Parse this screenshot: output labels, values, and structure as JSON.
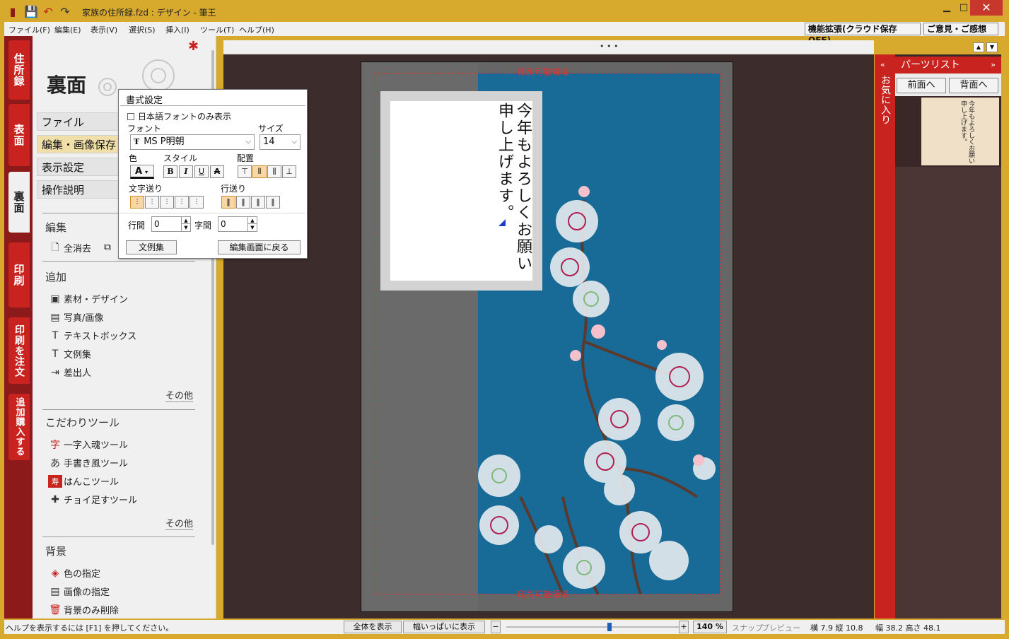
{
  "window": {
    "title": "家族の住所録.fzd : デザイン - 筆王",
    "minimize": "▁",
    "maximize": "□",
    "close": "✕"
  },
  "menu": {
    "items": [
      "ファイル(F)",
      "編集(E)",
      "表示(V)",
      "選択(S)",
      "挿入(I)",
      "ツール(T)",
      "ヘルプ(H)"
    ],
    "cloud": "機能拡張(クラウド保存OFF)",
    "feedback": "ご意見・ご感想"
  },
  "left_tabs": [
    "住所録",
    "表面",
    "裏面",
    "印刷",
    "印刷を注文",
    "追加購入する"
  ],
  "panel": {
    "title": "裏面",
    "buttons": [
      "ファイル",
      "編集・画像保存",
      "表示設定",
      "操作説明"
    ],
    "sections": {
      "edit": {
        "title": "編集",
        "items": [
          "全消去"
        ]
      },
      "add": {
        "title": "追加",
        "items": [
          "素材・デザイン",
          "写真/画像",
          "テキストボックス",
          "文例集",
          "差出人"
        ],
        "more": "その他"
      },
      "tools": {
        "title": "こだわりツール",
        "items": [
          "一字入魂ツール",
          "手書き風ツール",
          "はんこツール",
          "チョイ足すツール"
        ],
        "more": "その他"
      },
      "bg": {
        "title": "背景",
        "items": [
          "色の指定",
          "画像の指定",
          "背景のみ削除"
        ]
      }
    }
  },
  "canvas": {
    "dots": "• • •",
    "print_area_label": "印刷可能領域",
    "text_col1": "今年もよろしくお願い",
    "text_col2": "申し上げます。"
  },
  "dialog": {
    "title": "書式設定",
    "jp_font_only": "日本語フォントのみ表示",
    "font_label": "フォント",
    "font_value": "MS P明朝",
    "size_label": "サイズ",
    "size_value": "14",
    "color_label": "色",
    "style_label": "スタイル",
    "align_label": "配置",
    "char_feed_label": "文字送り",
    "line_feed_label": "行送り",
    "line_gap_label": "行間",
    "line_gap_value": "0",
    "char_gap_label": "字間",
    "char_gap_value": "0",
    "templates_button": "文例集",
    "back_button": "編集画面に戻る",
    "style_glyphs": [
      "B",
      "I",
      "U",
      "A"
    ]
  },
  "right_panel": {
    "favorites": "お気に入り",
    "title": "パーツリスト",
    "front": "前面へ",
    "back": "背面へ",
    "thumb_col1": "今年もよろしくお願い",
    "thumb_col2": "申し上げます。"
  },
  "status": {
    "help": "ヘルプを表示するには [F1] を押してください。",
    "fit_all": "全体を表示",
    "fit_width": "幅いっぱいに表示",
    "zoom": "140 %",
    "snap": "スナップ",
    "preview": "プレビュー",
    "pos": "横 7.9 縦 10.8",
    "size": "幅 38.2 高さ 48.1",
    "zoom_slider": 0.6
  },
  "colors": {
    "accent_red": "#c8231f",
    "title_gold": "#d7aa2e",
    "card_blue": "#176b96"
  }
}
